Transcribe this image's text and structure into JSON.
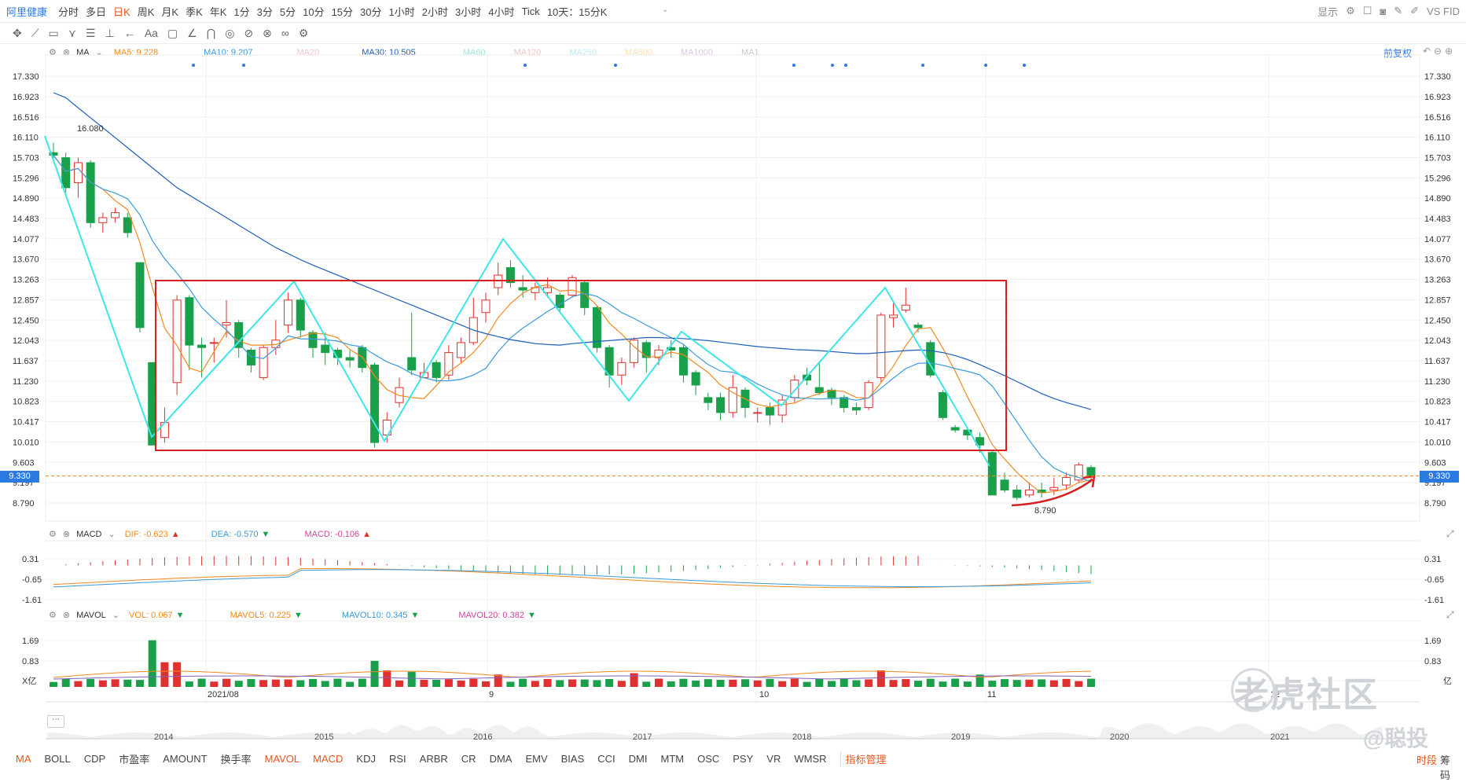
{
  "topbar": {
    "title": "阿里健康",
    "tabs": [
      "分时",
      "多日",
      "日K",
      "周K",
      "月K",
      "季K",
      "年K",
      "1分",
      "3分",
      "5分",
      "10分",
      "15分",
      "30分",
      "1小时",
      "2小时",
      "3小时",
      "4小时",
      "Tick",
      "10天：15分K"
    ],
    "active_tab": "日K",
    "right": {
      "display": "显示",
      "vs": "VS FID"
    }
  },
  "main": {
    "indicator": "MA",
    "ma": [
      {
        "label": "MA5: 9.228",
        "color": "#f0891e"
      },
      {
        "label": "MA10: 9.207",
        "color": "#3a9ad9"
      },
      {
        "label": "MA20",
        "color": "#f4c4d0"
      },
      {
        "label": "MA30: 10.505",
        "color": "#1e5fb8"
      },
      {
        "label": "MA60",
        "color": "#a6e3d8"
      },
      {
        "label": "MA120",
        "color": "#f4c4c4"
      },
      {
        "label": "MA250",
        "color": "#b8ecf4"
      },
      {
        "label": "MA500",
        "color": "#f8e0b4"
      },
      {
        "label": "MA1000",
        "color": "#e0c4ec"
      },
      {
        "label": "MA1",
        "color": "#c8c8c8"
      }
    ],
    "adjust_label": "前复权",
    "y_ticks": [
      "17.330",
      "16.923",
      "16.516",
      "16.110",
      "15.703",
      "15.296",
      "14.890",
      "14.483",
      "14.077",
      "13.670",
      "13.263",
      "12.857",
      "12.450",
      "12.043",
      "11.637",
      "11.230",
      "10.823",
      "10.417",
      "10.010",
      "9.603",
      "9.197",
      "8.790"
    ],
    "current_price": "9.330",
    "high_label": "16.080",
    "low_label": "8.790"
  },
  "macd": {
    "name": "MACD",
    "dif": "DIF: -0.623",
    "dea": "DEA: -0.570",
    "macd": "MACD: -0.106",
    "y_ticks": [
      "0.31",
      "-0.65",
      "-1.61"
    ]
  },
  "vol": {
    "name": "MAVOL",
    "vol": "VOL: 0.067",
    "mavol5": "MAVOL5: 0.225",
    "mavol10": "MAVOL10: 0.345",
    "mavol20": "MAVOL20: 0.382",
    "y_ticks": [
      "1.69",
      "0.83",
      "X亿"
    ],
    "unit": "亿"
  },
  "date_axis": [
    "2021/08",
    "9",
    "10",
    "11",
    "12"
  ],
  "navigator_years": [
    "2014",
    "2015",
    "2016",
    "2017",
    "2018",
    "2019",
    "2020",
    "2021"
  ],
  "bottombar": {
    "items": [
      "MA",
      "BOLL",
      "CDP",
      "市盈率",
      "AMOUNT",
      "换手率",
      "MAVOL",
      "MACD",
      "KDJ",
      "RSI",
      "ARBR",
      "CR",
      "DMA",
      "EMV",
      "BIAS",
      "CCI",
      "DMI",
      "MTM",
      "OSC",
      "PSY",
      "VR",
      "WMSR",
      "指标管理"
    ],
    "highlighted": [
      "MA",
      "MAVOL",
      "MACD",
      "指标管理"
    ],
    "right": [
      "时段",
      "筹码"
    ]
  },
  "watermark": {
    "text1": "老虎社区",
    "text2": "@聪投"
  },
  "chart_data": {
    "type": "candlestick",
    "ylim": [
      8.6,
      17.5
    ],
    "candles": [
      [
        15.8,
        15.75,
        16.0,
        15.6
      ],
      [
        15.7,
        15.1,
        15.8,
        15.0
      ],
      [
        15.2,
        15.6,
        15.7,
        14.9
      ],
      [
        15.6,
        14.4,
        15.65,
        14.3
      ],
      [
        14.4,
        14.5,
        14.6,
        14.2
      ],
      [
        14.5,
        14.6,
        14.7,
        14.4
      ],
      [
        14.5,
        14.2,
        14.6,
        14.1
      ],
      [
        13.6,
        12.3,
        13.6,
        12.2
      ],
      [
        11.6,
        9.95,
        11.6,
        9.95
      ],
      [
        10.1,
        10.4,
        10.7,
        10.0
      ],
      [
        11.2,
        12.85,
        12.95,
        10.95
      ],
      [
        12.9,
        11.95,
        12.95,
        11.45
      ],
      [
        11.95,
        11.9,
        12.1,
        11.3
      ],
      [
        12.0,
        12.0,
        12.1,
        11.6
      ],
      [
        12.35,
        12.4,
        12.85,
        12.1
      ],
      [
        12.4,
        11.9,
        12.45,
        11.7
      ],
      [
        11.85,
        11.55,
        11.9,
        11.4
      ],
      [
        11.3,
        11.9,
        11.95,
        11.25
      ],
      [
        11.9,
        12.05,
        12.45,
        11.75
      ],
      [
        12.35,
        12.85,
        13.0,
        12.2
      ],
      [
        12.85,
        12.25,
        12.9,
        12.1
      ],
      [
        12.2,
        11.9,
        12.25,
        11.7
      ],
      [
        11.95,
        11.8,
        12.2,
        11.55
      ],
      [
        11.85,
        11.7,
        11.9,
        11.55
      ],
      [
        11.7,
        11.65,
        11.85,
        11.5
      ],
      [
        11.9,
        11.5,
        11.95,
        11.4
      ],
      [
        11.55,
        10.0,
        11.6,
        9.9
      ],
      [
        10.15,
        10.45,
        10.6,
        10.0
      ],
      [
        10.8,
        11.1,
        11.3,
        10.7
      ],
      [
        11.7,
        11.45,
        12.6,
        11.35
      ],
      [
        11.3,
        11.4,
        11.6,
        11.3
      ],
      [
        11.6,
        11.3,
        11.65,
        11.2
      ],
      [
        11.35,
        11.8,
        11.95,
        11.25
      ],
      [
        11.7,
        12.0,
        12.1,
        11.6
      ],
      [
        12.0,
        12.5,
        12.9,
        11.95
      ],
      [
        12.6,
        12.85,
        13.0,
        12.4
      ],
      [
        13.1,
        13.35,
        13.6,
        12.95
      ],
      [
        13.5,
        13.2,
        13.65,
        13.1
      ],
      [
        13.1,
        13.05,
        13.35,
        12.9
      ],
      [
        13.0,
        13.1,
        13.2,
        12.85
      ],
      [
        13.0,
        13.1,
        13.3,
        12.9
      ],
      [
        12.95,
        12.7,
        13.0,
        12.6
      ],
      [
        12.95,
        13.3,
        13.35,
        12.9
      ],
      [
        13.2,
        12.7,
        13.25,
        12.55
      ],
      [
        12.7,
        11.9,
        12.75,
        11.8
      ],
      [
        11.9,
        11.35,
        11.95,
        11.1
      ],
      [
        11.35,
        11.6,
        11.7,
        11.15
      ],
      [
        11.6,
        12.05,
        12.1,
        11.5
      ],
      [
        12.0,
        11.7,
        12.05,
        11.4
      ],
      [
        11.7,
        11.85,
        11.95,
        11.55
      ],
      [
        11.9,
        11.85,
        12.05,
        11.7
      ],
      [
        11.9,
        11.35,
        11.95,
        11.2
      ],
      [
        11.4,
        11.15,
        11.45,
        10.95
      ],
      [
        10.9,
        10.8,
        11.0,
        10.65
      ],
      [
        10.9,
        10.6,
        11.0,
        10.45
      ],
      [
        10.6,
        11.1,
        11.35,
        10.5
      ],
      [
        11.05,
        10.7,
        11.1,
        10.5
      ],
      [
        10.6,
        10.6,
        10.7,
        10.4
      ],
      [
        10.7,
        10.55,
        10.8,
        10.35
      ],
      [
        10.55,
        10.85,
        10.95,
        10.4
      ],
      [
        10.9,
        11.25,
        11.35,
        10.8
      ],
      [
        11.35,
        11.25,
        11.5,
        11.15
      ],
      [
        11.1,
        11.0,
        11.6,
        10.95
      ],
      [
        11.05,
        10.9,
        11.1,
        10.75
      ],
      [
        10.9,
        10.7,
        10.95,
        10.6
      ],
      [
        10.7,
        10.65,
        10.8,
        10.55
      ],
      [
        10.7,
        11.2,
        11.25,
        10.65
      ],
      [
        11.3,
        12.55,
        12.6,
        11.2
      ],
      [
        12.5,
        12.55,
        12.8,
        12.3
      ],
      [
        12.65,
        12.75,
        13.1,
        12.6
      ],
      [
        12.35,
        12.3,
        12.4,
        12.2
      ],
      [
        12.0,
        11.35,
        12.05,
        11.3
      ],
      [
        11.0,
        10.5,
        11.05,
        10.45
      ],
      [
        10.3,
        10.25,
        10.35,
        10.2
      ],
      [
        10.25,
        10.15,
        10.3,
        10.05
      ],
      [
        10.1,
        9.95,
        10.2,
        9.8
      ],
      [
        9.8,
        8.95,
        9.85,
        8.95
      ],
      [
        9.25,
        9.05,
        9.4,
        9.0
      ],
      [
        9.05,
        8.9,
        9.15,
        8.85
      ],
      [
        8.95,
        9.05,
        9.2,
        8.9
      ],
      [
        9.05,
        9.0,
        9.2,
        8.9
      ],
      [
        9.05,
        9.1,
        9.3,
        8.95
      ],
      [
        9.15,
        9.3,
        9.4,
        9.05
      ],
      [
        9.25,
        9.55,
        9.6,
        9.2
      ],
      [
        9.5,
        9.33,
        9.55,
        9.2
      ]
    ]
  }
}
